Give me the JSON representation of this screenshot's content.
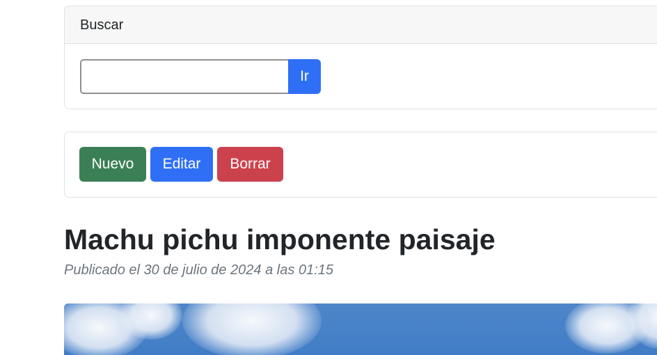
{
  "search": {
    "header": "Buscar",
    "input_value": "",
    "button_label": "Ir"
  },
  "actions": {
    "new_label": "Nuevo",
    "edit_label": "Editar",
    "delete_label": "Borrar"
  },
  "post": {
    "title": "Machu pichu imponente paisaje",
    "meta": "Publicado el 30 de julio de 2024 a las 01:15"
  },
  "colors": {
    "primary": "#2f6ff6",
    "success": "#3b7f56",
    "danger": "#cc424c",
    "muted": "#6c757d",
    "sky": "#4f86c9"
  }
}
